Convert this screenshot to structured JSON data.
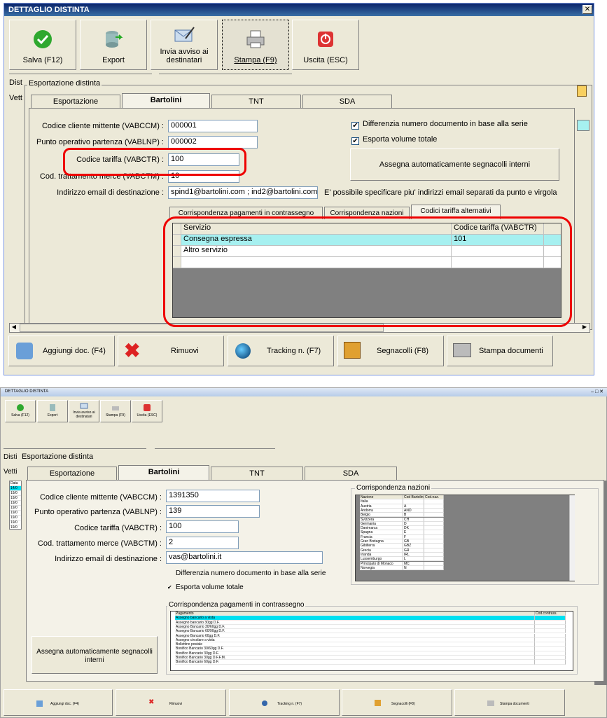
{
  "top": {
    "title": "DETTAGLIO DISTINTA",
    "close": "✕",
    "toolbar": [
      {
        "label": "Salva (F12)",
        "icon": "check-icon"
      },
      {
        "label": "Export",
        "icon": "database-export-icon"
      },
      {
        "label": "Invia avviso ai destinatari",
        "icon": "mail-send-icon"
      },
      {
        "label": "Stampa (F9)",
        "icon": "printer-icon"
      },
      {
        "label": "Uscita (ESC)",
        "icon": "exit-icon"
      }
    ],
    "behind_label_1": "Dist",
    "behind_label_2": "Vett",
    "frame_title": "Esportazione distinta",
    "tabs": [
      "Esportazione",
      "Bartolini",
      "TNT",
      "SDA"
    ],
    "fields": [
      {
        "label": "Codice cliente mittente (VABCCM) :",
        "value": "000001"
      },
      {
        "label": "Punto operativo partenza (VABLNP) :",
        "value": "000002"
      },
      {
        "label": "Codice tariffa (VABCTR) :",
        "value": "100"
      },
      {
        "label": "Cod. trattamento merce (VABCTM) :",
        "value": "10"
      },
      {
        "label": "Indirizzo email di destinazione :",
        "value": "spind1@bartolini.com ; ind2@bartolini.com"
      }
    ],
    "email_hint": "E' possibile specificare piu' indirizzi email separati da punto e virgola",
    "check_diff": "Differenzia numero documento in base alla serie",
    "check_vol": "Esporta volume totale",
    "check_mark": "✔",
    "assign_btn": "Assegna automaticamente segnacolli interni",
    "subtabs": [
      "Corrispondenza pagamenti in contrassegno",
      "Corrispondenza nazioni",
      "Codici tariffa alternativi"
    ],
    "grid": {
      "headers": [
        "Servizio",
        "Codice tariffa (VABCTR)"
      ],
      "rows": [
        [
          "Consegna espressa",
          "101"
        ],
        [
          "Altro servizio",
          ""
        ]
      ]
    },
    "bottom_buttons": [
      "Aggiungi doc. (F4)",
      "Rimuovi",
      "Tracking n. (F7)",
      "Segnacolli (F8)",
      "Stampa documenti"
    ],
    "colors": {
      "accent": "#0a246a",
      "highlight": "#a6f0f0",
      "annotation": "#e00000"
    }
  },
  "bottom": {
    "title": "DETTAGLIO DISTINTA",
    "controls": "–  □  ✕",
    "toolbar": [
      "Salva (F12)",
      "Export",
      "Invia avviso ai destinatari",
      "Stampa (F9)",
      "Uscita (ESC)"
    ],
    "behind_label_1": "Disti",
    "behind_label_2": "Vetti",
    "frame_title": "Esportazione distinta",
    "tabs": [
      "Esportazione",
      "Bartolini",
      "TNT",
      "SDA"
    ],
    "fields": [
      {
        "label": "Codice cliente mittente (VABCCM) :",
        "value": "1391350"
      },
      {
        "label": "Punto operativo partenza (VABLNP) :",
        "value": "139"
      },
      {
        "label": "Codice tariffa (VABCTR) :",
        "value": "100"
      },
      {
        "label": "Cod. trattamento merce (VABCTM) :",
        "value": "2"
      },
      {
        "label": "Indirizzo email di destinazione :",
        "value": "vas@bartolini.it"
      }
    ],
    "check_diff": "Differenzia numero documento in base alla serie",
    "check_vol": "Esporta volume totale",
    "check_mark": "✔",
    "nazioni_title": "Corrispondenza nazioni",
    "nazioni_headers": [
      "Nazione",
      "Cod Bartolini",
      "Cod.naz."
    ],
    "nazioni": [
      [
        "Italia",
        ""
      ],
      [
        "Austria",
        "A"
      ],
      [
        "Andorra",
        "AND"
      ],
      [
        "Belgio",
        "B"
      ],
      [
        "Svizzera",
        "CH"
      ],
      [
        "Germania",
        "D"
      ],
      [
        "Danimarca",
        "DK"
      ],
      [
        "Spagna",
        "E"
      ],
      [
        "Francia",
        "F"
      ],
      [
        "Gran Bretagna",
        "GB"
      ],
      [
        "Gibilterra",
        "GBZ"
      ],
      [
        "Grecia",
        "GR"
      ],
      [
        "Irlanda",
        "IRL"
      ],
      [
        "Lussemburgo",
        "L"
      ],
      [
        "Principato di Monaco",
        "MC"
      ],
      [
        "Norvegia",
        "N"
      ]
    ],
    "pag_title": "Corrispondenza pagamenti in contrassegno",
    "pag_headers": [
      "Pagamento",
      "Cod.contrass."
    ],
    "pagamenti": [
      "Assegno bancario a vista",
      "Assegno bancario 30gg D.F.",
      "Assegno Bancario 30/60gg D.F.",
      "Assegno Bancario 60/90gg D.F.",
      "Assegno Bancario 60gg D.F.",
      "Assegno circolare a vista",
      "Bollettino postale",
      "Bonifico Bancario 30/60gg D.F.",
      "Bonifico Bancario 30gg D.F.",
      "Bonifico Bancario 30gg D.F.F.M.",
      "Bonifico Bancario 60gg D.F."
    ],
    "assign_btn": "Assegna automaticamente segnacolli interni",
    "bottom_buttons": [
      "Aggiungi doc. (F4)",
      "Rimuovi",
      "Tracking n. (F7)",
      "Segnacolli (F8)",
      "Stampa documenti"
    ],
    "list_items": [
      "Data",
      "14/0",
      "19/0",
      "19/0",
      "19/0",
      "19/0",
      "19/0",
      "19/0",
      "19/0",
      "19/0"
    ]
  }
}
